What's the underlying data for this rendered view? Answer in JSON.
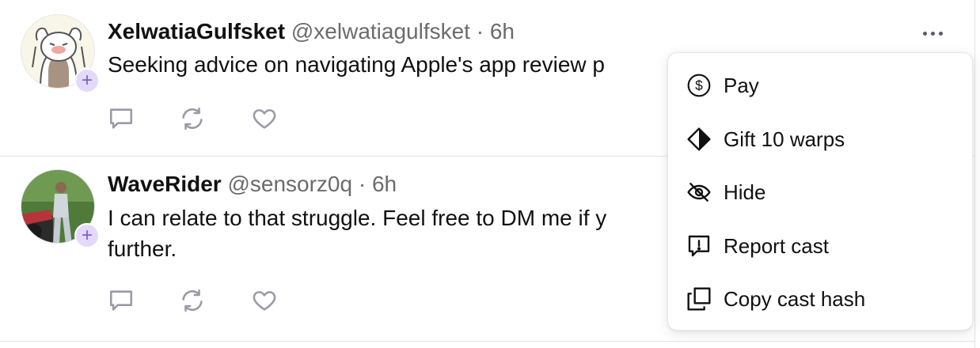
{
  "casts": [
    {
      "display_name": "XelwatiaGulfsket",
      "handle": "@xelwatiagulfsket",
      "separator": "·",
      "time": "6h",
      "text": "Seeking advice on navigating Apple's app review p"
    },
    {
      "display_name": "WaveRider",
      "handle": "@sensorz0q",
      "separator": "·",
      "time": "6h",
      "text_line1": "I can relate to that struggle. Feel free to DM me if y",
      "text_line2": "further."
    }
  ],
  "menu": {
    "items": [
      {
        "label": "Pay",
        "icon": "dollar-circle-icon"
      },
      {
        "label": "Gift 10 warps",
        "icon": "warp-diamond-icon"
      },
      {
        "label": "Hide",
        "icon": "eye-slash-icon"
      },
      {
        "label": "Report cast",
        "icon": "report-icon"
      },
      {
        "label": "Copy cast hash",
        "icon": "copy-icon"
      }
    ]
  },
  "icons": {
    "reply": "comment-icon",
    "recast": "recast-icon",
    "like": "heart-icon",
    "more": "more-horizontal-icon",
    "follow": "plus-icon"
  },
  "colors": {
    "badge_bg": "#e3dafb",
    "badge_fg": "#7c5cd6",
    "muted_text": "#6b6b6b",
    "action_icon": "#9a9aa6"
  }
}
